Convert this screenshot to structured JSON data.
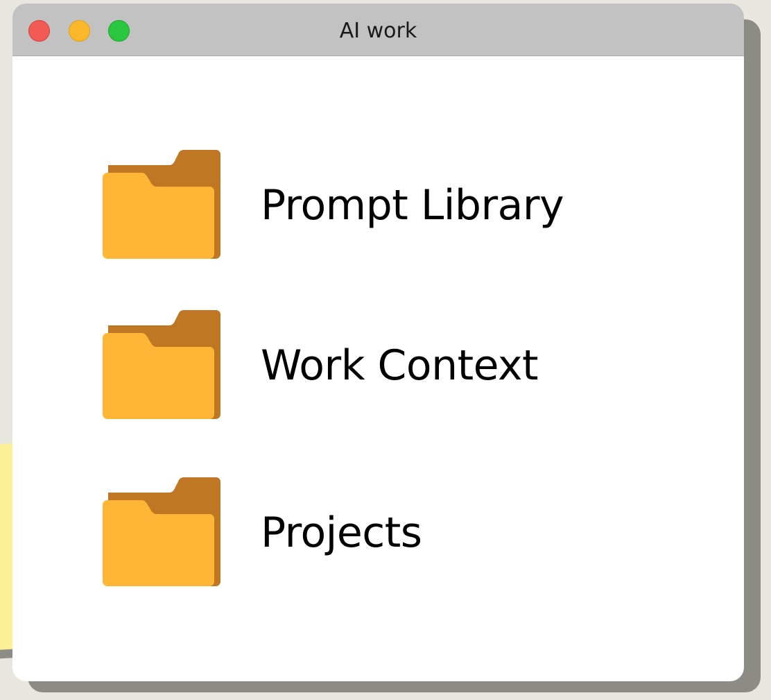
{
  "window": {
    "title": "AI work"
  },
  "folders": [
    {
      "label": "Prompt Library",
      "icon": "folder-icon"
    },
    {
      "label": "Work Context",
      "icon": "folder-icon"
    },
    {
      "label": "Projects",
      "icon": "folder-icon"
    }
  ],
  "colors": {
    "folder_front": "#ffb636",
    "folder_back": "#bf7724",
    "titlebar": "#c2c2c2",
    "sticky_note": "#fdef96",
    "close": "#f25a54",
    "minimize": "#fbb72a",
    "zoom": "#2bc63f"
  }
}
